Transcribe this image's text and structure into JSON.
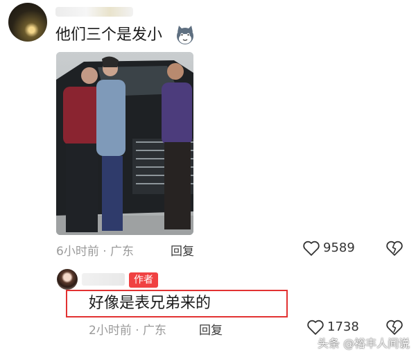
{
  "comments": [
    {
      "text": "他们三个是发小",
      "time": "6小时前 · 广东",
      "reply_label": "回复",
      "likes": "9589",
      "icons": {
        "like": "heart-outline-icon",
        "dislike": "broken-heart-icon",
        "emoji": "cat-face-icon"
      }
    }
  ],
  "reply": {
    "author_badge": "作者",
    "text": "好像是表兄弟来的",
    "time": "2小时前 · 广东",
    "reply_label": "回复",
    "likes": "1738",
    "highlight_color": "#e23131"
  },
  "watermark": "头条 @裕丰人间说",
  "colors": {
    "badge": "#f04142",
    "meta": "#9a9a9a"
  }
}
